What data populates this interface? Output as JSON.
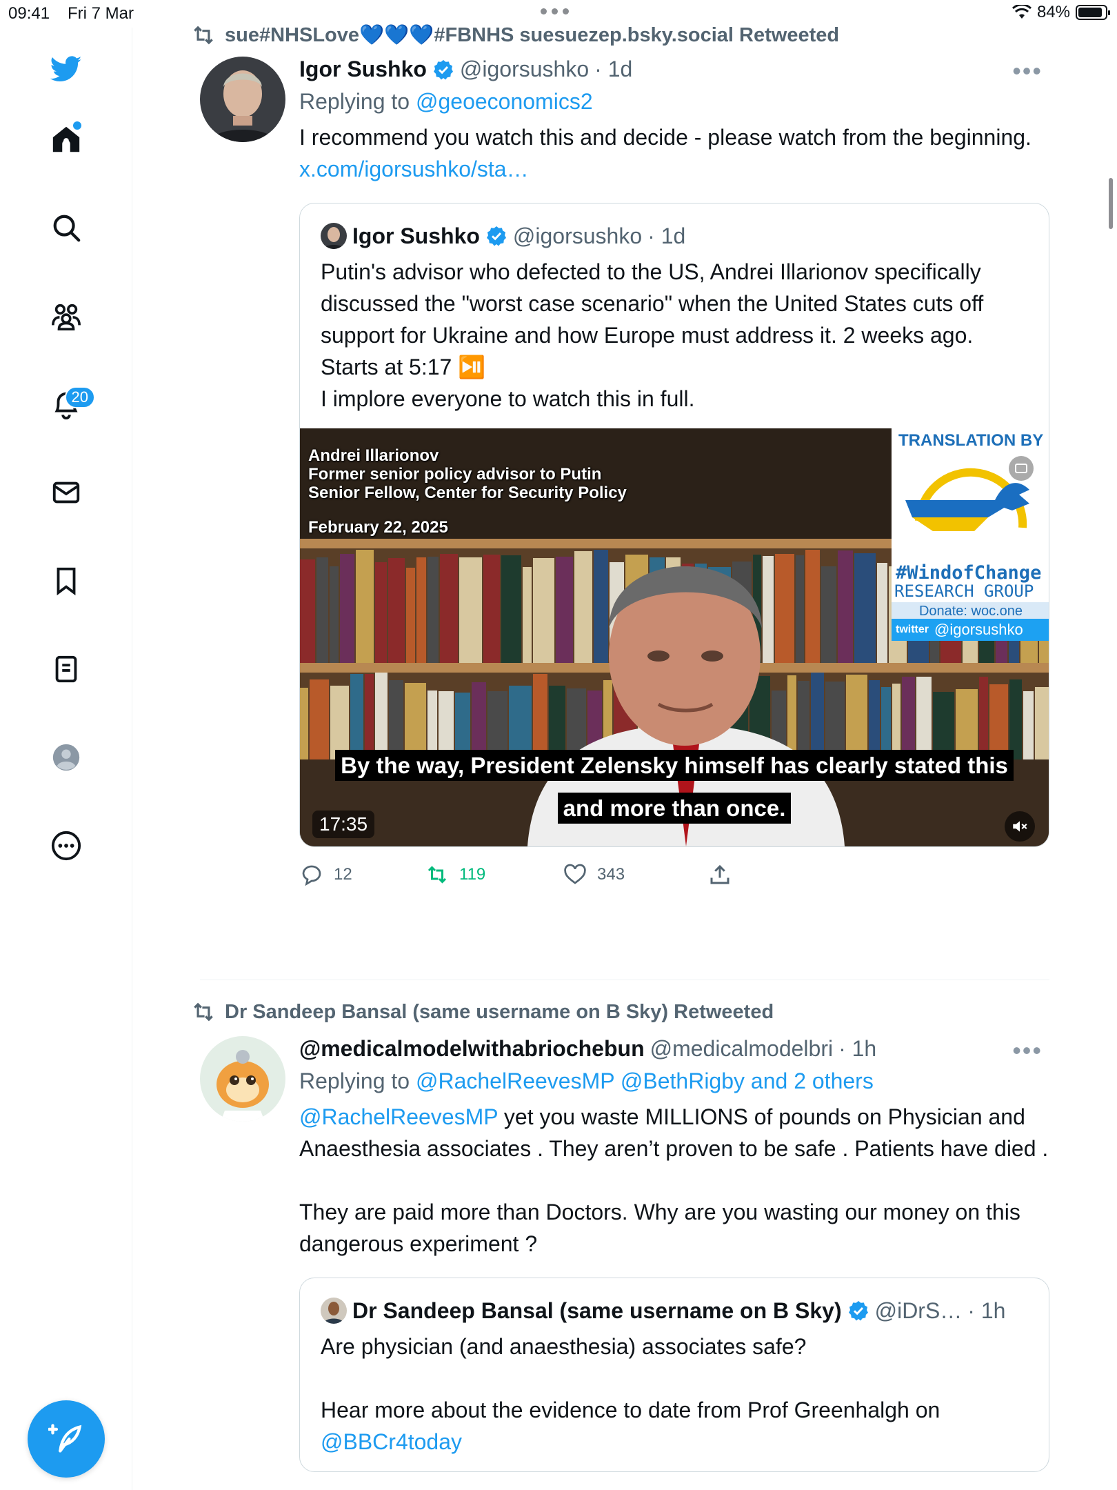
{
  "status_bar": {
    "time": "09:41",
    "date": "Fri 7 Mar",
    "battery": "84%",
    "battery_level": 0.84
  },
  "sidebar": {
    "items": [
      {
        "name": "home",
        "icon": "home-icon"
      },
      {
        "name": "explore",
        "icon": "search-icon"
      },
      {
        "name": "communities",
        "icon": "people-icon"
      },
      {
        "name": "notifications",
        "icon": "bell-icon",
        "badge": "20"
      },
      {
        "name": "messages",
        "icon": "mail-icon"
      },
      {
        "name": "bookmarks",
        "icon": "bookmark-icon"
      },
      {
        "name": "lists",
        "icon": "list-icon"
      },
      {
        "name": "profile",
        "icon": "profile-icon"
      },
      {
        "name": "more",
        "icon": "more-circle-icon"
      }
    ],
    "compose_icon": "compose-icon"
  },
  "tweets": [
    {
      "retweeted_by": "sue#NHSLove💙💙💙#FBNHS suesuezep.bsky.social Retweeted",
      "name": "Igor Sushko",
      "handle": "@igorsushko",
      "time": "· 1d",
      "replying_prefix": "Replying to",
      "replying_to": "@geoeconomics2",
      "text": "I recommend you watch this and decide - please watch from the beginning.",
      "link": "x.com/igorsushko/sta…",
      "quote": {
        "name": "Igor Sushko",
        "handle": "@igorsushko",
        "time": "· 1d",
        "text": "Putin's advisor who defected to the US, Andrei Illarionov specifically discussed the \"worst case scenario\" when the United States cuts off support for Ukraine and how Europe must address it. 2 weeks ago.\nStarts at 5:17 ⏯️\nI implore everyone to watch this in full.",
        "video": {
          "caption_name": "Andrei Illarionov",
          "caption_role1": "Former senior policy advisor to Putin",
          "caption_role2": "Senior Fellow, Center for Security Policy",
          "caption_date": "February 22, 2025",
          "subtitle_line1": "By the way, President Zelensky himself has clearly stated this",
          "subtitle_line2": "and more than once.",
          "duration": "17:35",
          "logo_top": "TRANSLATION BY",
          "logo_tag": "#WindofChange",
          "logo_group": "RESEARCH GROUP",
          "logo_donate": "Donate: woc.one",
          "logo_twitter_label": "twitter",
          "logo_twitter_handle": "@igorsushko"
        }
      },
      "actions": {
        "replies": "12",
        "retweets": "119",
        "likes": "343"
      }
    },
    {
      "retweeted_by": "Dr Sandeep Bansal (same username on B Sky) Retweeted",
      "name": "@medicalmodelwithabriochebun",
      "handle": "@medicalmodelbri",
      "time": "· 1h",
      "replying_prefix": "Replying to",
      "replying_to": "@RachelReevesMP @BethRigby and 2 others",
      "mention": "@RachelReevesMP",
      "text": " yet you waste MILLIONS of pounds on Physician and Anaesthesia associates . They aren’t proven to be safe . Patients have died .\n\nThey are paid more than Doctors. Why are you wasting our money on this dangerous experiment ?",
      "quote": {
        "name": "Dr Sandeep Bansal (same username on B Sky)",
        "handle": "@iDrS…",
        "time": "· 1h",
        "text": "Are physician (and anaesthesia) associates safe?\n\nHear more about the evidence to date from Prof Greenhalgh on",
        "mention": "@BBCr4today"
      }
    }
  ],
  "colors": {
    "accent": "#1d9bf0",
    "text": "#0f1419",
    "muted": "#536471",
    "retweet_green": "#00ba7c",
    "border": "#cfd9de"
  }
}
